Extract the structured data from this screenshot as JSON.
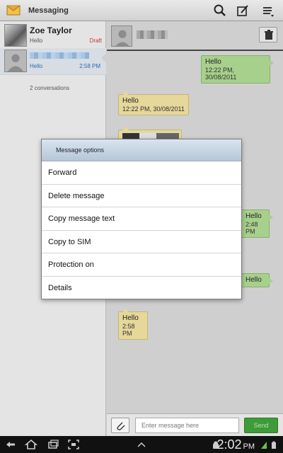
{
  "app": {
    "title": "Messaging"
  },
  "conversations": [
    {
      "name": "Zoe Taylor",
      "snippet": "Hello",
      "status": "Draft"
    },
    {
      "snippet": "Hello",
      "time": "2:58 PM"
    }
  ],
  "conversation_count": "2 conversations",
  "messages": [
    {
      "direction": "sent",
      "text": "Hello",
      "time": "12:22 PM, 30/08/2011"
    },
    {
      "direction": "received",
      "text": "Hello",
      "time": "12:22 PM, 30/08/2011"
    },
    {
      "direction": "received",
      "type": "image"
    },
    {
      "direction": "sent",
      "text": "Hello",
      "time": "2:48 PM"
    },
    {
      "direction": "sent",
      "text": "Hello",
      "time": ""
    },
    {
      "direction": "received",
      "text": "Hello",
      "time": "2:58 PM"
    }
  ],
  "compose": {
    "placeholder": "Enter message here",
    "send_label": "Send"
  },
  "dialog": {
    "title": "Message options",
    "options": [
      "Forward",
      "Delete message",
      "Copy message text",
      "Copy to SIM",
      "Protection on",
      "Details"
    ]
  },
  "system": {
    "clock": "2:02",
    "clock_suffix": "PM"
  },
  "colors": {
    "sent_bubble": "#a7d08c",
    "received_bubble": "#e6d79a",
    "send_button": "#3f9a3a",
    "draft_label": "#c03a2b"
  },
  "icons": [
    "messaging-app-icon",
    "search-icon",
    "compose-icon",
    "menu-icon",
    "trash-icon",
    "attach-icon",
    "back-icon",
    "home-icon",
    "recent-apps-icon",
    "screenshot-icon",
    "android-icon"
  ]
}
